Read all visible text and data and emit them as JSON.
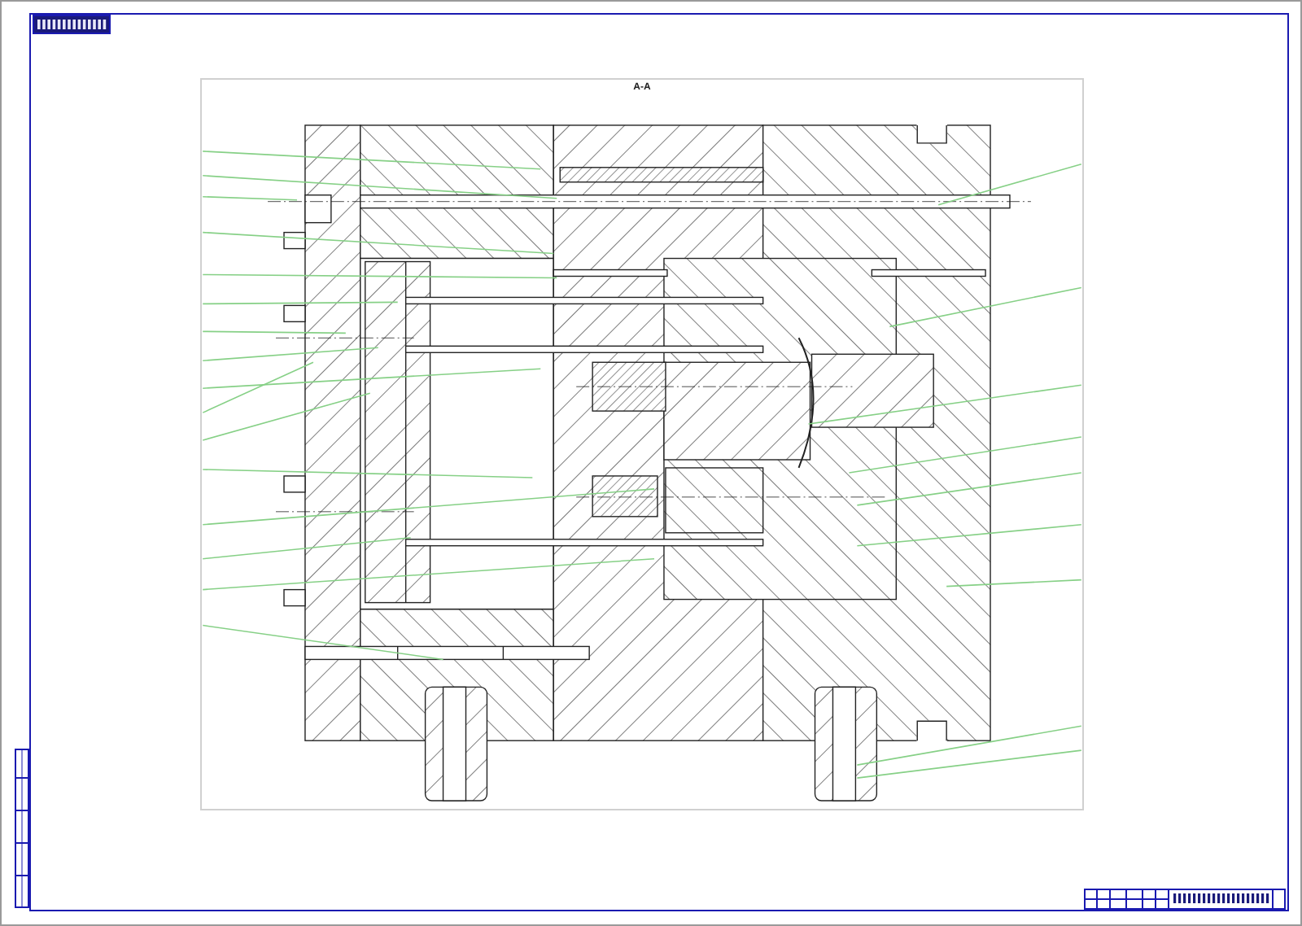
{
  "drawing": {
    "section_label": "А-А"
  }
}
